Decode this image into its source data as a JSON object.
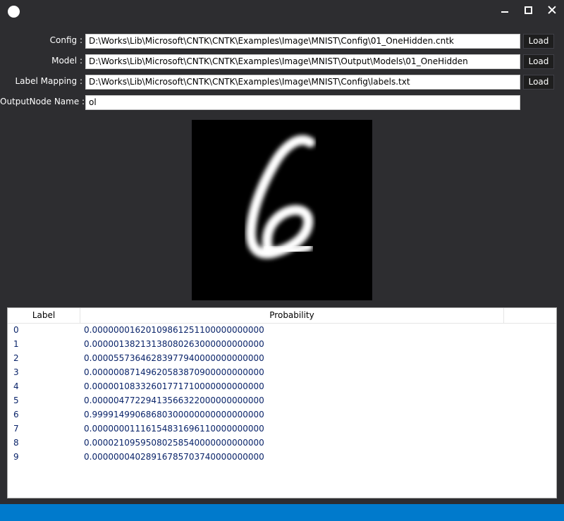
{
  "window": {
    "icon": "app-circle-icon",
    "controls": [
      "minimize-icon",
      "maximize-icon",
      "close-icon"
    ]
  },
  "form": {
    "config": {
      "label": "Config :",
      "value": "D:\\Works\\Lib\\Microsoft\\CNTK\\CNTK\\Examples\\Image\\MNIST\\Config\\01_OneHidden.cntk",
      "button": "Load"
    },
    "model": {
      "label": "Model :",
      "value": "D:\\Works\\Lib\\Microsoft\\CNTK\\CNTK\\Examples\\Image\\MNIST\\Output\\Models\\01_OneHidden",
      "button": "Load"
    },
    "label_mapping": {
      "label": "Label Mapping :",
      "value": "D:\\Works\\Lib\\Microsoft\\CNTK\\CNTK\\Examples\\Image\\MNIST\\Config\\labels.txt",
      "button": "Load"
    },
    "output_node": {
      "label": "OutputNode Name :",
      "value": "ol"
    }
  },
  "image": {
    "description_icon": "mnist-digit-image"
  },
  "grid": {
    "columns": [
      "Label",
      "Probability"
    ],
    "rows": [
      {
        "label": "0",
        "probability": "0.00000001620109861251100000000000"
      },
      {
        "label": "1",
        "probability": "0.00000138213138080263000000000000"
      },
      {
        "label": "2",
        "probability": "0.00005573646283977940000000000000"
      },
      {
        "label": "3",
        "probability": "0.00000087149620583870900000000000"
      },
      {
        "label": "4",
        "probability": "0.00000108332601771710000000000000"
      },
      {
        "label": "5",
        "probability": "0.00000477229413566322000000000000"
      },
      {
        "label": "6",
        "probability": "0.99991499068680300000000000000000"
      },
      {
        "label": "7",
        "probability": "0.00000001116154831696110000000000"
      },
      {
        "label": "8",
        "probability": "0.00002109595080258540000000000000"
      },
      {
        "label": "9",
        "probability": "0.00000004028916785703740000000000"
      }
    ]
  },
  "colors": {
    "window_bg": "#2d2d30",
    "status_bar": "#007acc",
    "grid_text": "#0a246a"
  }
}
